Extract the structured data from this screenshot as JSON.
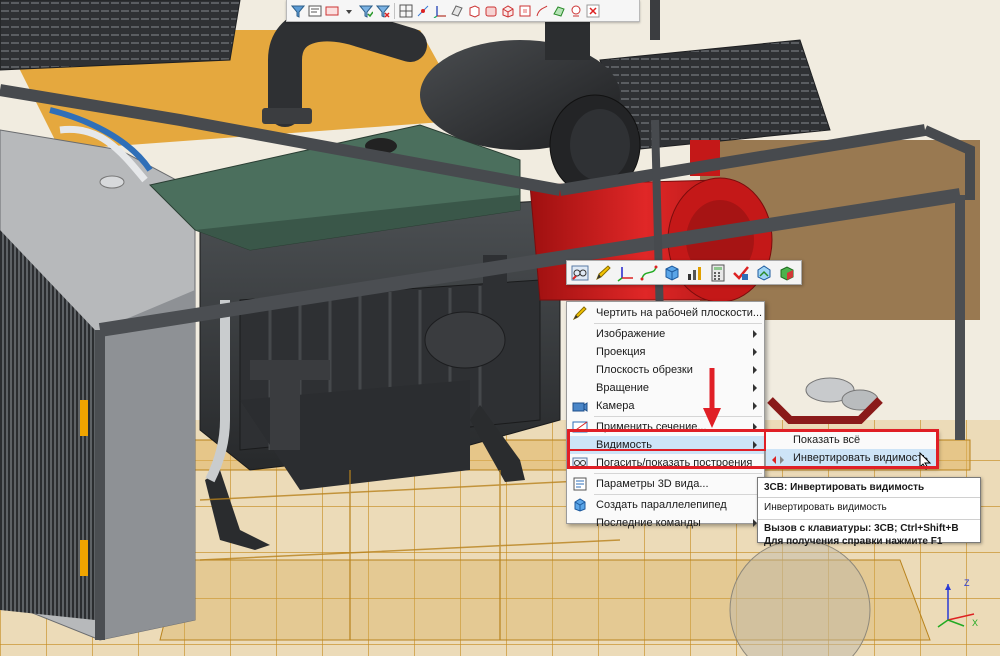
{
  "colors": {
    "highlight": "#e01f26",
    "menu_active": "#cde4f7",
    "engine_block": "#3a3d3f",
    "valve_cover": "#4a6e5c",
    "red_component": "#d91c1c",
    "frame": "#4b4e52",
    "transparent_parts": "#d9a640"
  },
  "top_toolbar": {
    "icons": [
      "filter-icon",
      "filter-edit-icon",
      "select-frame-icon",
      "select-dropdown-icon",
      "filter-check-icon",
      "filter-x-icon",
      "grid-icon",
      "point-icon",
      "axis-icon",
      "plane-icon",
      "solid-icon",
      "body-icon",
      "box-icon",
      "shell-icon",
      "sketch-icon",
      "surface-icon",
      "text-icon",
      "cross-icon"
    ]
  },
  "mini_toolbar": {
    "icons": [
      "glasses-icon",
      "pencil-icon",
      "axis-icon",
      "curve-icon",
      "cube-icon",
      "measure-icon",
      "calculator-icon",
      "checkmark-icon",
      "view-icon",
      "color-cube-icon"
    ]
  },
  "context_menu": {
    "items": [
      {
        "label": "Чертить на рабочей плоскости...",
        "icon": "pencil-icon",
        "submenu": false
      },
      {
        "label": "Изображение",
        "icon": "",
        "submenu": true
      },
      {
        "label": "Проекция",
        "icon": "",
        "submenu": true
      },
      {
        "label": "Плоскость обрезки",
        "icon": "",
        "submenu": true
      },
      {
        "label": "Вращение",
        "icon": "",
        "submenu": true
      },
      {
        "label": "Камера",
        "icon": "camera-icon",
        "submenu": true
      },
      {
        "label": "Применить сечение...",
        "icon": "section-icon",
        "submenu": true
      },
      {
        "label": "Видимость",
        "icon": "",
        "submenu": true
      },
      {
        "label": "Погасить/показать построения",
        "icon": "constructions-icon",
        "submenu": false
      },
      {
        "label": "Параметры 3D вида...",
        "icon": "params-icon",
        "submenu": false
      },
      {
        "label": "Создать параллелепипед",
        "icon": "box-icon",
        "submenu": false
      },
      {
        "label": "Последние команды",
        "icon": "",
        "submenu": true
      }
    ]
  },
  "visibility_submenu": {
    "items": [
      {
        "label": "Показать всё",
        "icon": ""
      },
      {
        "label": "Инвертировать видимость",
        "icon": "invert-visibility-icon"
      }
    ]
  },
  "tooltip": {
    "title": "3CB: Инвертировать видимость",
    "description": "Инвертировать видимость",
    "shortcut": "Вызов с клавиатуры: 3CB; Ctrl+Shift+B",
    "help": "Для получения справки нажмите F1"
  },
  "axis_labels": {
    "z": "Z",
    "x": "X"
  }
}
